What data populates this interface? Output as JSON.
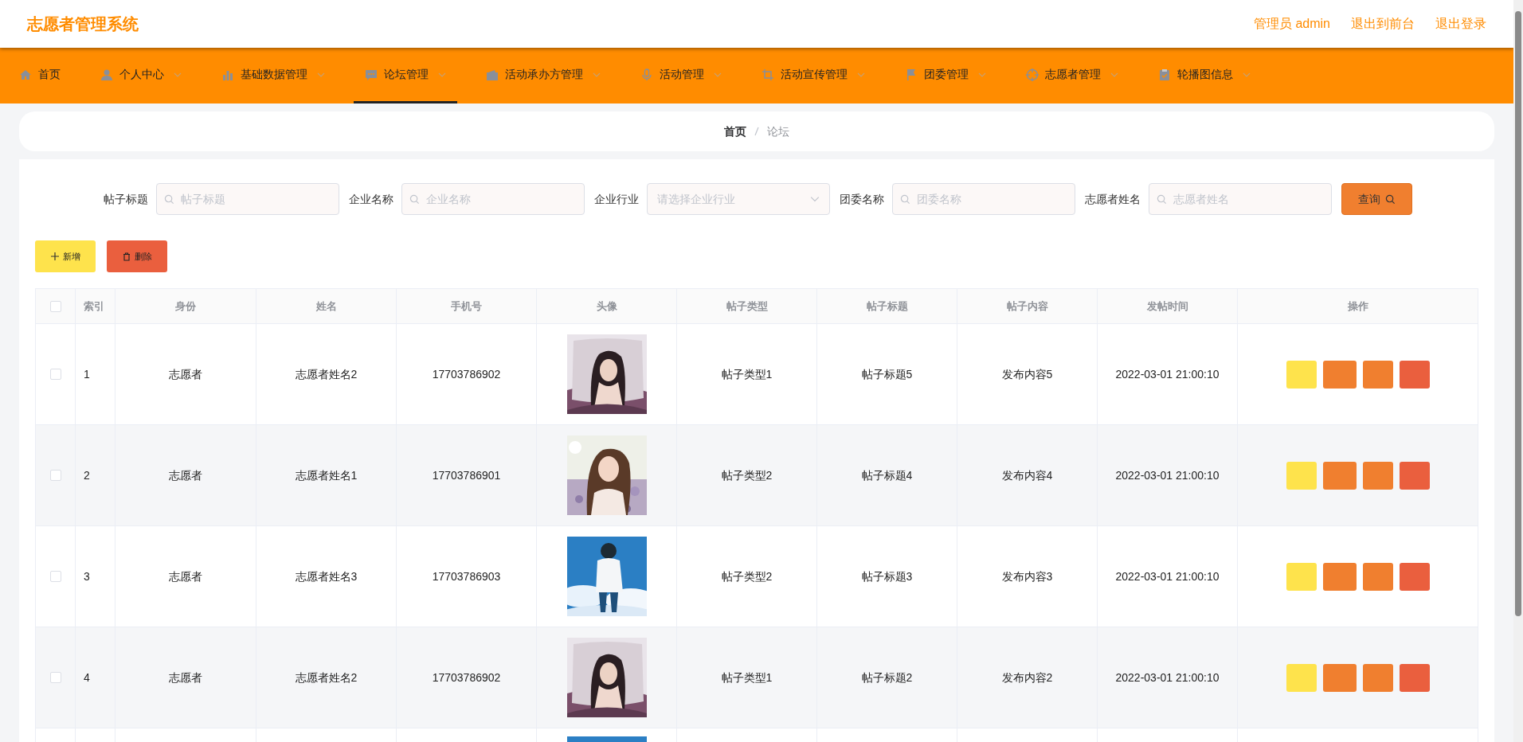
{
  "header": {
    "title": "志愿者管理系统",
    "links": [
      "管理员 admin",
      "退出到前台",
      "退出登录"
    ]
  },
  "nav": [
    {
      "label": "首页",
      "selected": false,
      "dropdown": false
    },
    {
      "label": "个人中心",
      "selected": false,
      "dropdown": true
    },
    {
      "label": "基础数据管理",
      "selected": false,
      "dropdown": true
    },
    {
      "label": "论坛管理",
      "selected": true,
      "dropdown": true
    },
    {
      "label": "活动承办方管理",
      "selected": false,
      "dropdown": true
    },
    {
      "label": "活动管理",
      "selected": false,
      "dropdown": true
    },
    {
      "label": "活动宣传管理",
      "selected": false,
      "dropdown": true
    },
    {
      "label": "团委管理",
      "selected": false,
      "dropdown": true
    },
    {
      "label": "志愿者管理",
      "selected": false,
      "dropdown": true
    },
    {
      "label": "轮播图信息",
      "selected": false,
      "dropdown": true
    }
  ],
  "breadcrumb": [
    "首页",
    "论坛"
  ],
  "filters": [
    {
      "label": "帖子标题",
      "kind": "text",
      "placeholder": "帖子标题"
    },
    {
      "label": "企业名称",
      "kind": "text",
      "placeholder": "企业名称"
    },
    {
      "label": "企业行业",
      "kind": "select",
      "placeholder": "请选择企业行业"
    },
    {
      "label": "团委名称",
      "kind": "text",
      "placeholder": "团委名称"
    },
    {
      "label": "志愿者姓名",
      "kind": "text",
      "placeholder": "志愿者姓名"
    }
  ],
  "search_button": "查询",
  "toolbar": [
    "新增",
    "删除"
  ],
  "table": {
    "all_checked": false,
    "columns": [
      "索引",
      "身份",
      "姓名",
      "手机号",
      "头像",
      "帖子类型",
      "帖子标题",
      "帖子内容",
      "发帖时间",
      "操作"
    ],
    "rows": [
      {
        "checked": false,
        "cells": [
          "1",
          "志愿者",
          "志愿者姓名2",
          "17703786902",
          "帖子类型1",
          "帖子标题5",
          "发布内容5",
          "2022-03-01 21:00:10"
        ]
      },
      {
        "checked": false,
        "cells": [
          "2",
          "志愿者",
          "志愿者姓名1",
          "17703786901",
          "帖子类型2",
          "帖子标题4",
          "发布内容4",
          "2022-03-01 21:00:10"
        ]
      },
      {
        "checked": false,
        "cells": [
          "3",
          "志愿者",
          "志愿者姓名3",
          "17703786903",
          "帖子类型2",
          "帖子标题3",
          "发布内容3",
          "2022-03-01 21:00:10"
        ]
      },
      {
        "checked": false,
        "cells": [
          "4",
          "志愿者",
          "志愿者姓名2",
          "17703786902",
          "帖子类型1",
          "帖子标题2",
          "发布内容2",
          "2022-03-01 21:00:10"
        ]
      },
      {
        "partial": true
      }
    ]
  }
}
